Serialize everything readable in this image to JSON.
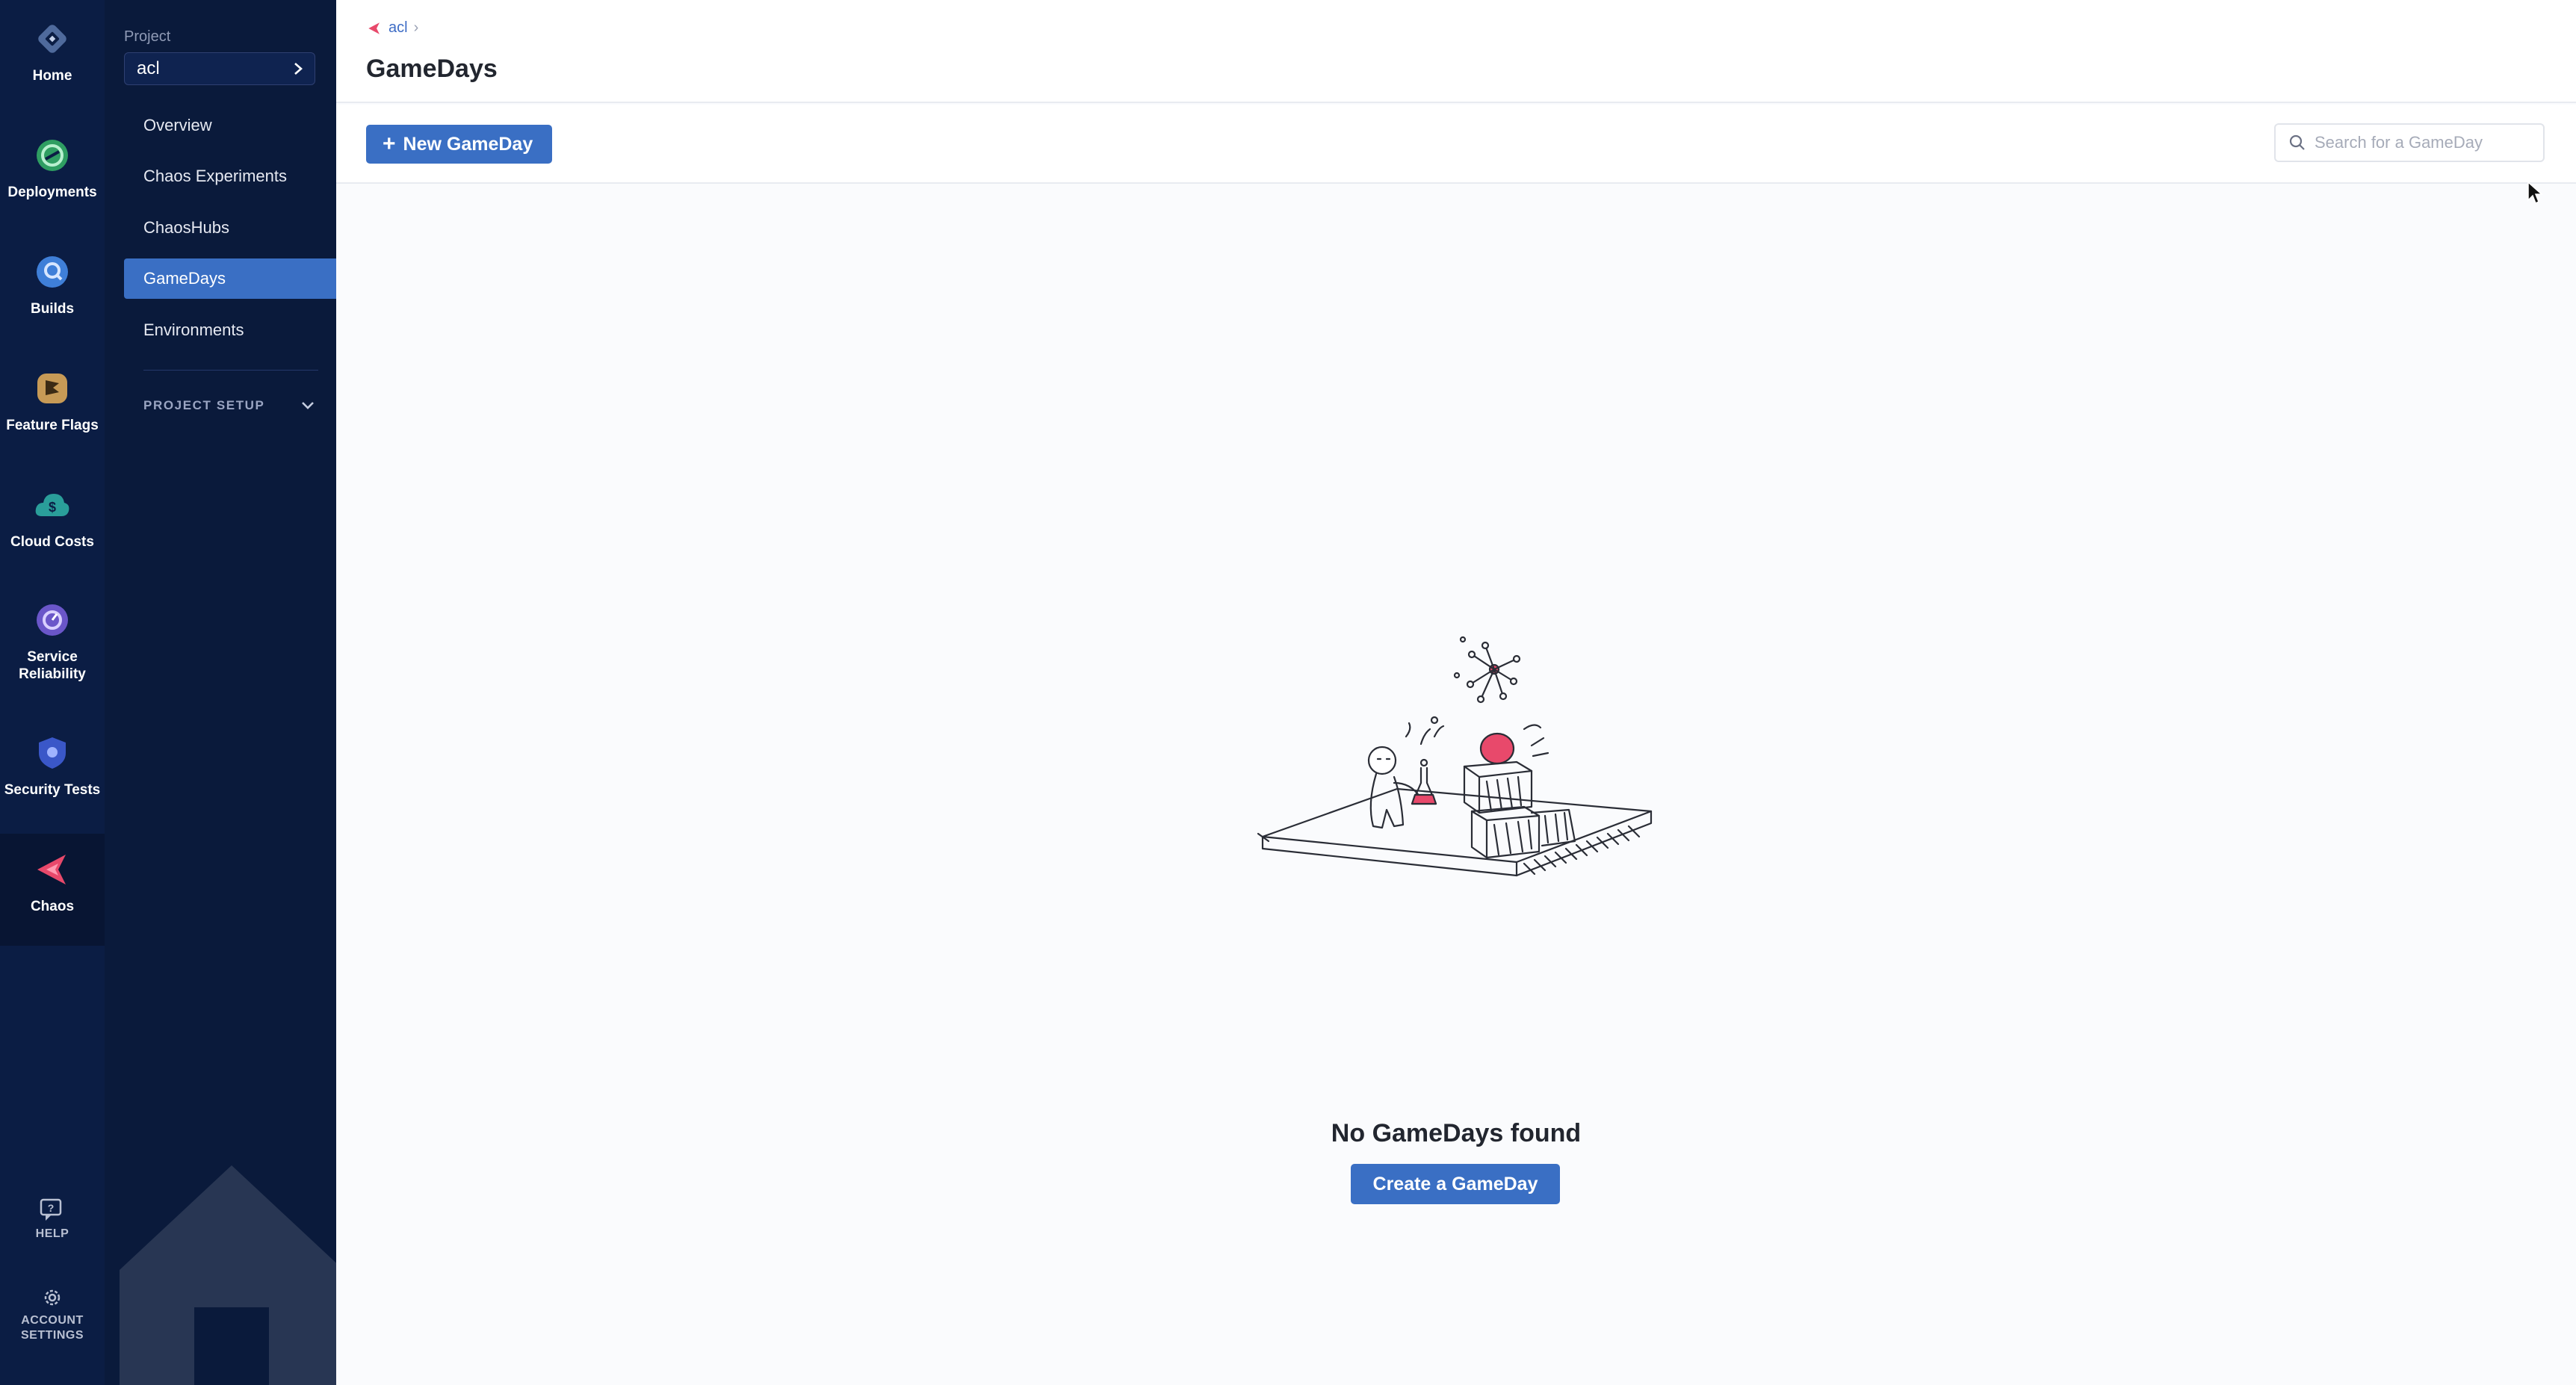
{
  "rail": {
    "items": [
      {
        "label": "Home",
        "icon": "home-icon"
      },
      {
        "label": "Deployments",
        "icon": "deployments-icon"
      },
      {
        "label": "Builds",
        "icon": "builds-icon"
      },
      {
        "label": "Feature Flags",
        "icon": "feature-flags-icon"
      },
      {
        "label": "Cloud Costs",
        "icon": "cloud-costs-icon"
      },
      {
        "label": "Service\nReliability",
        "icon": "service-reliability-icon"
      },
      {
        "label": "Security Tests",
        "icon": "security-tests-icon"
      },
      {
        "label": "Chaos",
        "icon": "chaos-icon",
        "active": true
      }
    ],
    "help_label": "HELP",
    "account_settings_label": "ACCOUNT\nSETTINGS"
  },
  "nav": {
    "project_label": "Project",
    "project_value": "acl",
    "items": [
      {
        "label": "Overview"
      },
      {
        "label": "Chaos Experiments"
      },
      {
        "label": "ChaosHubs"
      },
      {
        "label": "GameDays",
        "active": true
      },
      {
        "label": "Environments"
      }
    ],
    "project_setup_label": "PROJECT SETUP"
  },
  "header": {
    "breadcrumb": "acl",
    "title": "GameDays"
  },
  "toolbar": {
    "new_button_label": "New GameDay",
    "search_placeholder": "Search for a GameDay"
  },
  "empty_state": {
    "message": "No GameDays found",
    "create_button_label": "Create a GameDay"
  },
  "colors": {
    "rail_bg": "#0b1d44",
    "nav_bg": "#0a1a3b",
    "accent": "#3a6fc4",
    "chaos_pink": "#e8496b"
  }
}
